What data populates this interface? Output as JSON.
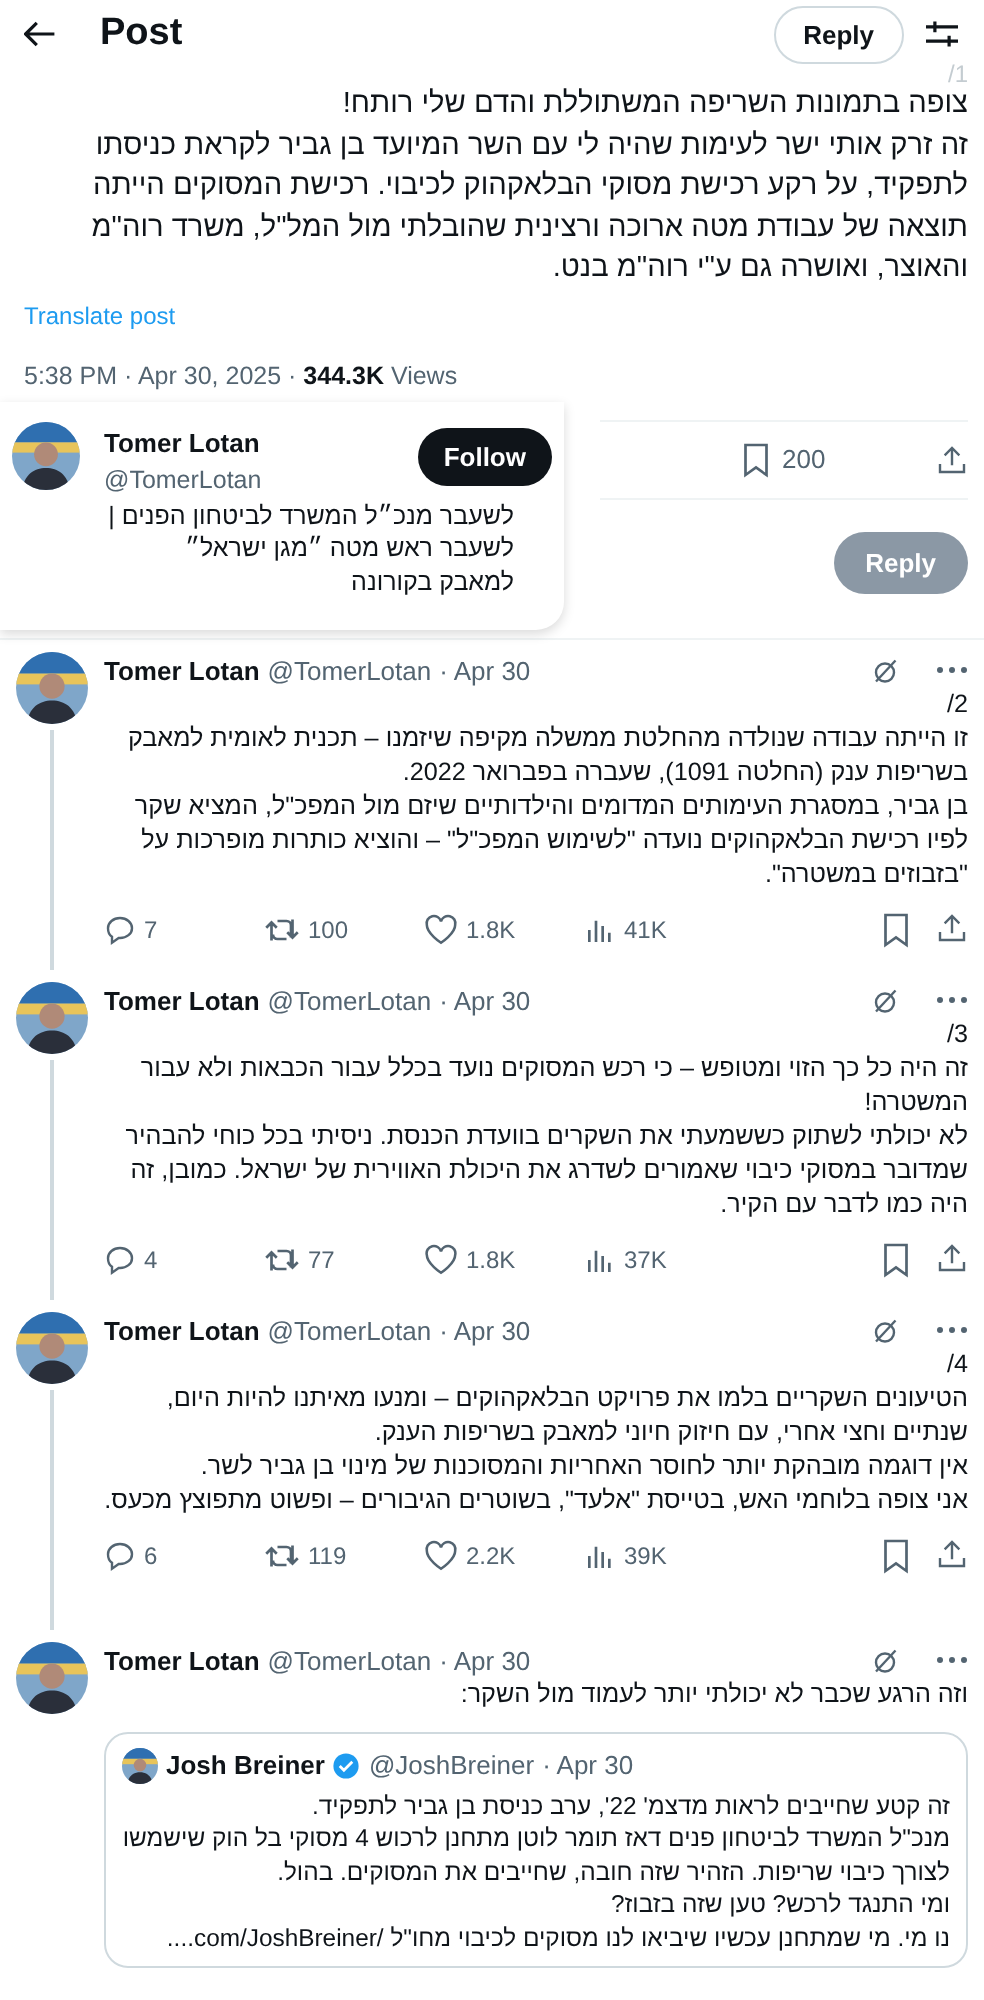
{
  "header": {
    "title": "Post",
    "reply_button": "Reply",
    "thread_mark": "/1"
  },
  "post": {
    "paragraphs": [
      "צופה בתמונות השריפה המשתוללת והדם שלי רותח!",
      "זה זרק אותי ישר לעימות שהיה לי עם השר המיועד בן גביר לקראת כניסתו לתפקיד, על רקע רכישת מסוקי הבלאקהוק לכיבוי. רכישת המסוקים הייתה תוצאה של עבודת מטה ארוכה ורצינית שהובלתי מול המל\"ל, משרד רוה\"מ והאוצר, ואושרה גם ע\"י רוה\"מ בנט."
    ],
    "translate": "Translate post",
    "time": "5:38 PM · Apr 30, 2025 · ",
    "views_count": "344.3K",
    "views_label": "Views",
    "bookmarks": "200"
  },
  "hover_card": {
    "name": "Tomer Lotan",
    "handle": "@TomerLotan",
    "follow": "Follow",
    "bio": "לשעבר מנכ״ל המשרד לביטחון הפנים | לשעבר ראש מטה ״מגן ישראל״ למאבק בקורונה"
  },
  "reply_box": {
    "button": "Reply",
    "disabled": true
  },
  "replies": [
    {
      "name": "Tomer Lotan",
      "handle": "@TomerLotan",
      "date": "· Apr 30",
      "thread_continues": true,
      "paragraphs": [
        "2/",
        "זו הייתה עבודה שנולדה מהחלטת ממשלה מקיפה שיזמנו – תכנית לאומית למאבק בשריפות ענק (החלטה 1091), שעברה בפברואר 2022.",
        "בן גביר, במסגרת העימותים המדומים והילדותיים שיזם מול המפכ\"ל, המציא שקר לפיו רכישת הבלאקהוקים נועדה \"לשימוש המפכ\"ל\" – והוציא כותרות מופרכות על \"בזבוזים במשטרה\"."
      ],
      "stats": {
        "replies": "7",
        "reposts": "100",
        "likes": "1.8K",
        "views": "41K"
      }
    },
    {
      "name": "Tomer Lotan",
      "handle": "@TomerLotan",
      "date": "· Apr 30",
      "thread_continues": true,
      "paragraphs": [
        "3/",
        "זה היה כל כך הזוי ומטופש – כי רכש המסוקים נועד בכלל עבור הכבאות ולא עבור המשטרה!",
        "לא יכולתי לשתוק כששמעתי את השקרים בוועדת הכנסת. ניסיתי בכל כוחי להבהיר שמדובר במסוקי כיבוי שאמורים לשדרג את היכולת האווירית של ישראל. כמובן, זה היה כמו לדבר עם הקיר."
      ],
      "stats": {
        "replies": "4",
        "reposts": "77",
        "likes": "1.8K",
        "views": "37K"
      }
    },
    {
      "name": "Tomer Lotan",
      "handle": "@TomerLotan",
      "date": "· Apr 30",
      "thread_continues": true,
      "paragraphs": [
        "4/",
        "הטיעונים השקריים בלמו את פרויקט הבלאקהוקים – ומנעו מאיתנו להיות היום, שנתיים וחצי אחרי, עם חיזוק חיוני למאבק בשריפות הענק.",
        "אין דוגמה מובהקת יותר לחוסר האחריות והמסוכנות של מינוי בן גביר לשר.",
        "אני צופה בלוחמי האש, בטייסת \"אלעד\", בשוטרים הגיבורים – ופשוט מתפוצץ מכעס."
      ],
      "stats": {
        "replies": "6",
        "reposts": "119",
        "likes": "2.2K",
        "views": "39K"
      }
    },
    {
      "name": "Tomer Lotan",
      "handle": "@TomerLotan",
      "date": "· Apr 30",
      "thread_continues": false,
      "paragraphs": [
        "וזה הרגע שכבר לא יכולתי יותר לעמוד מול השקר:"
      ],
      "quote": {
        "name": "Josh Breiner",
        "verified": true,
        "handle": "@JoshBreiner",
        "date": "· Apr 30",
        "paragraphs": [
          "זה קטע שחייבים לראות מדצמ' 22', ערב כניסת בן גביר לתפקיד.",
          "מנכ\"ל המשרד לביטחון פנים דאז תומר לוטן מתחנן לרכוש 4 מסוקי בל הוק שישמשו לצורך כיבוי שריפות. הזהיר שזה חובה, שחייבים את המסוקים. בהול.",
          "ומי התנגד לרכש? טען שזה בזבוז?",
          "נו מי. מי שמתחנן עכשיו שיביאו לנו מסוקים לכיבוי מחו\"ל /com/JoshBreiner...."
        ]
      }
    }
  ]
}
